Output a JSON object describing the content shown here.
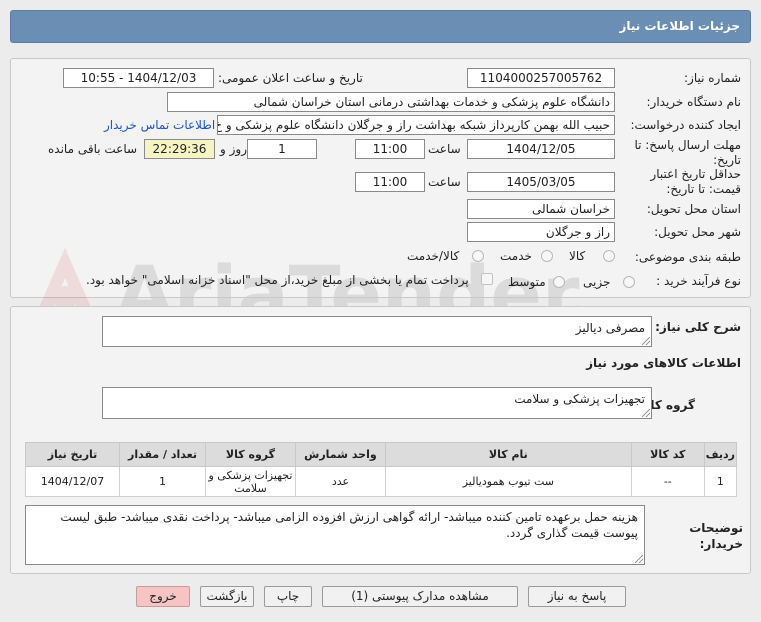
{
  "header": {
    "title": "جزئیات اطلاعات نیاز"
  },
  "fields": {
    "need_number_label": "شماره نیاز:",
    "need_number": "1104000257005762",
    "announce_label": "تاریخ و ساعت اعلان عمومی:",
    "announce_value": "1404/12/03 - 10:55",
    "buyer_label": "نام دستگاه خریدار:",
    "buyer_value": "دانشگاه علوم پزشکی و خدمات بهداشتی درمانی استان خراسان شمالی",
    "creator_label": "ایجاد کننده درخواست:",
    "creator_value": "حبیب الله بهمن کارپرداز شبکه بهداشت راز و جرگلان دانشگاه علوم پزشکی و خ",
    "contact_link": "اطلاعات تماس خریدار",
    "reply_deadline_label": "مهلت ارسال پاسخ: تا تاریخ:",
    "reply_date": "1404/12/05",
    "time_label": "ساعت",
    "reply_time": "11:00",
    "days_value": "1",
    "days_label": "روز و",
    "remaining_time": "22:29:36",
    "remaining_label": "ساعت باقی مانده",
    "price_validity_label": "حداقل تاریخ اعتبار قیمت: تا تاریخ:",
    "price_date": "1405/03/05",
    "price_time": "11:00",
    "province_label": "استان محل تحویل:",
    "province_value": "خراسان شمالی",
    "city_label": "شهر محل تحویل:",
    "city_value": "راز و جرگلان",
    "category_label": "طبقه بندی موضوعی:",
    "category_options": [
      "کالا",
      "خدمت",
      "کالا/خدمت"
    ],
    "process_label": "نوع فرآیند خرید :",
    "process_options": [
      "جزیی",
      "متوسط"
    ],
    "payment_note": "پرداخت تمام یا بخشی از مبلغ خرید،از محل \"اسناد خزانه اسلامی\" خواهد بود."
  },
  "summary": {
    "general_desc_label": "شرح کلی نیاز:",
    "general_desc": "مصرفی دیالیز",
    "goods_info_label": "اطلاعات کالاهای مورد نیاز",
    "goods_group_label": "گروه کالا:",
    "goods_group": "تجهیزات پزشکی و سلامت"
  },
  "table": {
    "headers": [
      "ردیف",
      "کد کالا",
      "نام کالا",
      "واحد شمارش",
      "گروه کالا",
      "تعداد / مقدار",
      "تاریخ نیاز"
    ],
    "rows": [
      [
        "1",
        "--",
        "ست تیوب همودیالیز",
        "عدد",
        "تجهیزات پزشکی و سلامت",
        "1",
        "1404/12/07"
      ]
    ]
  },
  "buyer_notes": {
    "label": "توضیحات خریدار:",
    "text": "هزینه حمل برعهده تامین کننده میباشد- ارائه گواهی ارزش افزوده الزامی میباشد- پرداخت نقدی میباشد- طبق لیست پیوست قیمت گذاری گردد."
  },
  "buttons": {
    "reply": "پاسخ به نیاز",
    "attachments": "مشاهده مدارک پیوستی (1)",
    "print": "چاپ",
    "back": "بازگشت",
    "exit": "خروج"
  },
  "colors": {
    "header": "#6b8fb4",
    "link": "#1b55c8",
    "exit_button": "#f7c4c4",
    "remaining_box": "#f5f5c4"
  },
  "watermark_text": "AriaTender.net"
}
